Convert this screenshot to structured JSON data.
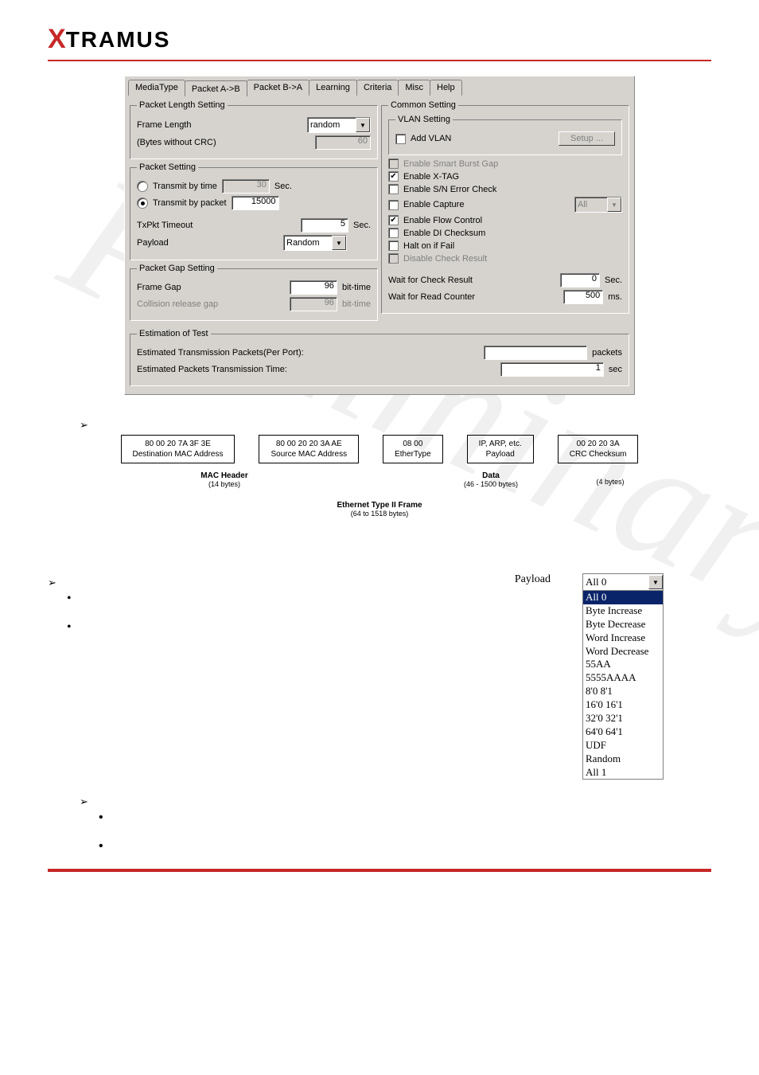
{
  "logo": {
    "prefix": "X",
    "rest": "TRAMUS"
  },
  "tabs": [
    "MediaType",
    "Packet A->B",
    "Packet B->A",
    "Learning",
    "Criteria",
    "Misc",
    "Help"
  ],
  "active_tab": "Packet A->B",
  "packet_length": {
    "legend": "Packet Length Setting",
    "frame_length_label": "Frame Length",
    "frame_length_value": "random",
    "bytes_label": "(Bytes without CRC)",
    "bytes_value": "60"
  },
  "packet_setting": {
    "legend": "Packet Setting",
    "transmit_time_label": "Transmit by time",
    "transmit_time_value": "30",
    "sec": "Sec.",
    "transmit_packet_label": "Transmit by packet",
    "transmit_packet_value": "15000",
    "txpkt_label": "TxPkt Timeout",
    "txpkt_value": "5",
    "payload_label": "Payload",
    "payload_value": "Random"
  },
  "packet_gap": {
    "legend": "Packet Gap Setting",
    "frame_gap_label": "Frame Gap",
    "frame_gap_value": "96",
    "bt": "bit-time",
    "collision_label": "Collision release gap",
    "collision_value": "96"
  },
  "common": {
    "legend": "Common Setting",
    "vlan": {
      "legend": "VLAN Setting",
      "add_label": "Add VLAN",
      "setup": "Setup ..."
    },
    "opts": {
      "smart_burst": "Enable Smart Burst Gap",
      "xtag": "Enable X-TAG",
      "sn_error": "Enable S/N Error Check",
      "capture": "Enable Capture",
      "capture_sel": "All",
      "flow": "Enable Flow Control",
      "di_check": "Enable DI Checksum",
      "halt": "Halt on if Fail",
      "disable_check": "Disable Check Result"
    },
    "wait_check": "Wait for Check Result",
    "wait_check_val": "0",
    "wait_check_unit": "Sec.",
    "wait_read": "Wait for Read Counter",
    "wait_read_val": "500",
    "wait_read_unit": "ms."
  },
  "estimation": {
    "legend": "Estimation of Test",
    "l1": "Estimated Transmission Packets(Per Port):",
    "l1_val": "",
    "l1_unit": "packets",
    "l2": "Estimated Packets Transmission Time:",
    "l2_val": "1",
    "l2_unit": "sec"
  },
  "diagram": {
    "b1a": "80  00  20  7A  3F  3E",
    "b1b": "Destination MAC Address",
    "b2a": "80  00  20  20  3A  AE",
    "b2b": "Source MAC Address",
    "b3a": "08  00",
    "b3b": "EtherType",
    "b4a": "IP, ARP, etc.",
    "b4b": "Payload",
    "b5a": "00  20  20  3A",
    "b5b": "CRC Checksum",
    "mac_header": "MAC Header",
    "mac_sub": "(14 bytes)",
    "data": "Data",
    "data_sub": "(46 - 1500 bytes)",
    "crc_sub": "(4 bytes)",
    "frame": "Ethernet Type II Frame",
    "frame_sub": "(64 to 1518 bytes)"
  },
  "payload_sel": {
    "label": "Payload",
    "current": "All 0",
    "options": [
      "All 0",
      "Byte Increase",
      "Byte Decrease",
      "Word Increase",
      "Word Decrease",
      "55AA",
      "5555AAAA",
      "8'0 8'1",
      "16'0 16'1",
      "32'0 32'1",
      "64'0 64'1",
      "UDF",
      "Random",
      "All 1"
    ]
  },
  "watermark": "Preliminary"
}
